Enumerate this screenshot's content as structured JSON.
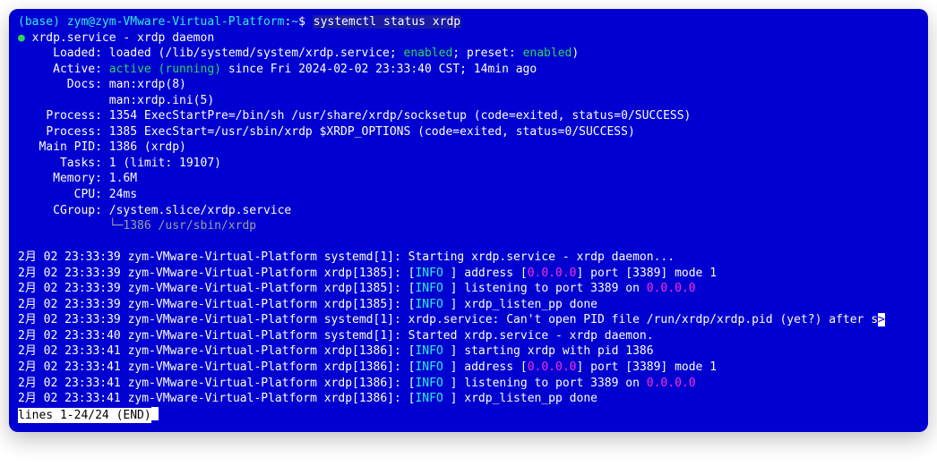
{
  "prompt": {
    "env": "(base)",
    "userhost": "zym@zym-VMware-Virtual-Platform",
    "path": "~",
    "sep": "$",
    "command": "systemctl status xrdp"
  },
  "unit": {
    "bullet": "●",
    "name": "xrdp.service - xrdp daemon",
    "loaded_label": "Loaded:",
    "loaded_value_pre": "loaded (/lib/systemd/system/xrdp.service; ",
    "loaded_enabled": "enabled",
    "loaded_mid": "; preset: ",
    "loaded_preset": "enabled",
    "loaded_post": ")",
    "active_label": "Active:",
    "active_state": "active (running)",
    "active_since": " since Fri 2024-02-02 23:33:40 CST; 14min ago",
    "docs_label": "Docs:",
    "docs_1": "man:xrdp(8)",
    "docs_2": "man:xrdp.ini(5)",
    "process1_label": "Process:",
    "process1_value": "1354 ExecStartPre=/bin/sh /usr/share/xrdp/socksetup (code=exited, status=0/SUCCESS)",
    "process2_label": "Process:",
    "process2_value": "1385 ExecStart=/usr/sbin/xrdp $XRDP_OPTIONS (code=exited, status=0/SUCCESS)",
    "mainpid_label": "Main PID:",
    "mainpid_value": "1386 (xrdp)",
    "tasks_label": "Tasks:",
    "tasks_value": "1 (limit: 19107)",
    "memory_label": "Memory:",
    "memory_value": "1.6M",
    "cpu_label": "CPU:",
    "cpu_value": "24ms",
    "cgroup_label": "CGroup:",
    "cgroup_value": "/system.slice/xrdp.service",
    "cgroup_tree": "└─",
    "cgroup_proc": "1386 /usr/sbin/xrdp"
  },
  "logs": [
    {
      "ts": "2月 02 23:33:39 zym-VMware-Virtual-Platform systemd[1]: ",
      "info": "",
      "rest": "Starting xrdp.service - xrdp daemon..."
    },
    {
      "ts": "2月 02 23:33:39 zym-VMware-Virtual-Platform xrdp[1385]: ",
      "info": "INFO ",
      "rest_a": "] address [",
      "addr": "0.0.0.0",
      "rest_b": "] port [3389] mode 1"
    },
    {
      "ts": "2月 02 23:33:39 zym-VMware-Virtual-Platform xrdp[1385]: ",
      "info": "INFO ",
      "rest_a": "] listening to port 3389 on ",
      "addr": "0.0.0.0",
      "rest_b": ""
    },
    {
      "ts": "2月 02 23:33:39 zym-VMware-Virtual-Platform xrdp[1385]: ",
      "info": "INFO ",
      "rest_a": "] xrdp_listen_pp done",
      "addr": "",
      "rest_b": ""
    },
    {
      "ts": "2月 02 23:33:39 zym-VMware-Virtual-Platform systemd[1]: ",
      "info": "",
      "rest": "xrdp.service: Can't open PID file /run/xrdp/xrdp.pid (yet?) after s",
      "trunc": ">"
    },
    {
      "ts": "2月 02 23:33:40 zym-VMware-Virtual-Platform systemd[1]: ",
      "info": "",
      "rest": "Started xrdp.service - xrdp daemon."
    },
    {
      "ts": "2月 02 23:33:41 zym-VMware-Virtual-Platform xrdp[1386]: ",
      "info": "INFO ",
      "rest_a": "] starting xrdp with pid 1386",
      "addr": "",
      "rest_b": ""
    },
    {
      "ts": "2月 02 23:33:41 zym-VMware-Virtual-Platform xrdp[1386]: ",
      "info": "INFO ",
      "rest_a": "] address [",
      "addr": "0.0.0.0",
      "rest_b": "] port [3389] mode 1"
    },
    {
      "ts": "2月 02 23:33:41 zym-VMware-Virtual-Platform xrdp[1386]: ",
      "info": "INFO ",
      "rest_a": "] listening to port 3389 on ",
      "addr": "0.0.0.0",
      "rest_b": ""
    },
    {
      "ts": "2月 02 23:33:41 zym-VMware-Virtual-Platform xrdp[1386]: ",
      "info": "INFO ",
      "rest_a": "] xrdp_listen_pp done",
      "addr": "",
      "rest_b": ""
    }
  ],
  "pager": "lines 1-24/24 (END)"
}
